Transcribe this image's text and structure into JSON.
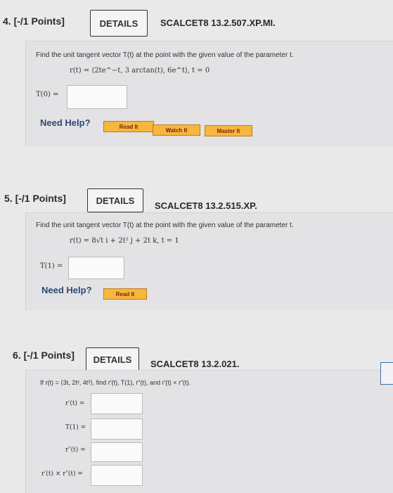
{
  "q4": {
    "header": "4. [-/1 Points]",
    "details_label": "DETAILS",
    "code": "SCALCET8 13.2.507.XP.MI.",
    "prompt": "Find the unit tangent vector T(t) at the point with the given value of the parameter t.",
    "equation": "r(t) = ⟨2te^−t, 3 arctan(t), 6e^t⟩,    t = 0",
    "answer_label": "T(0) =",
    "need_help": "Need Help?",
    "buttons": [
      "Read It",
      "Watch It",
      "Master It"
    ]
  },
  "q5": {
    "header": "5. [-/1 Points]",
    "details_label": "DETAILS",
    "code": "SCALCET8 13.2.515.XP.",
    "prompt": "Find the unit tangent vector T(t) at the point with the given value of the parameter t.",
    "equation": "r(t) = 8√t i + 2t² j + 2t k,    t = 1",
    "answer_label": "T(1) =",
    "need_help": "Need Help?",
    "buttons": [
      "Read It"
    ]
  },
  "q6": {
    "header": "6. [-/1 Points]",
    "details_label": "DETAILS",
    "code": "SCALCET8 13.2.021.",
    "prompt": "If r(t) = ⟨3t, 2t², 4t³⟩, find r′(t), T(1), r″(t), and r′(t) × r″(t).",
    "fields": [
      {
        "label": "r′(t) ="
      },
      {
        "label": "T(1) ="
      },
      {
        "label": "r″(t) ="
      },
      {
        "label": "r′(t) × r″(t) ="
      }
    ]
  }
}
